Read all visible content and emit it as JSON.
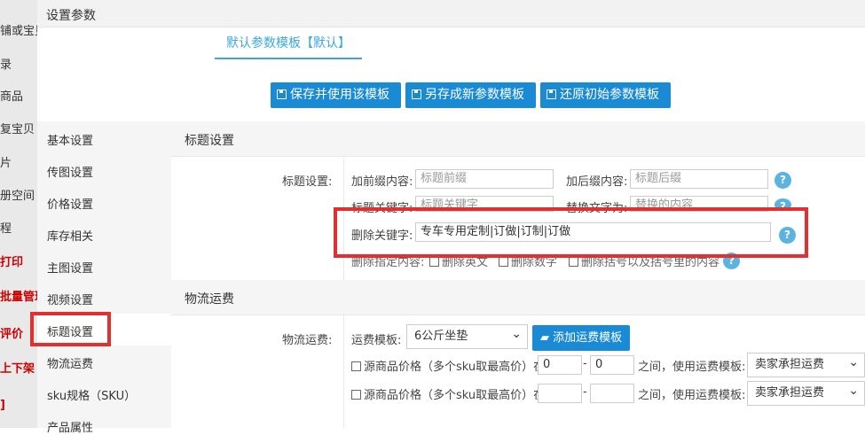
{
  "left_nav": {
    "items": [
      {
        "label": "铺或宝贝",
        "style": "normal"
      },
      {
        "label": "录",
        "style": "normal"
      },
      {
        "label": "商品",
        "style": "normal"
      },
      {
        "label": "复宝贝",
        "style": "normal"
      },
      {
        "label": "片",
        "style": "normal"
      },
      {
        "label": "册空间",
        "style": "normal"
      },
      {
        "label": "程",
        "style": "normal"
      },
      {
        "label": "打印",
        "style": "red"
      },
      {
        "label": "批量管理",
        "style": "red"
      },
      {
        "label": "评价",
        "style": "red"
      },
      {
        "label": "上下架",
        "style": "red"
      },
      {
        "label": "]",
        "style": "red"
      }
    ]
  },
  "header": {
    "title": "设置参数"
  },
  "tabs": [
    {
      "label": "默认参数模板【默认】",
      "active": true
    }
  ],
  "toolbar": {
    "save_use": "保存并使用该模板",
    "save_new": "另存成新参数模板",
    "restore": "还原初始参数模板"
  },
  "side_menu": {
    "items": [
      {
        "label": "基本设置"
      },
      {
        "label": "传图设置"
      },
      {
        "label": "价格设置"
      },
      {
        "label": "库存相关"
      },
      {
        "label": "主图设置"
      },
      {
        "label": "视频设置"
      },
      {
        "label": "标题设置",
        "active": true
      },
      {
        "label": "物流运费"
      },
      {
        "label": "sku规格（SKU）"
      },
      {
        "label": "产品属性"
      }
    ]
  },
  "title_section": {
    "heading": "标题设置",
    "row_label": "标题设置:",
    "prefix_label": "加前缀内容:",
    "prefix_placeholder": "标题前缀",
    "suffix_label": "加后缀内容:",
    "suffix_placeholder": "标题后缀",
    "keyword_label": "标题关键字:",
    "keyword_placeholder": "标题关键字",
    "replace_label": "替换文字为:",
    "replace_placeholder": "替换的内容",
    "delete_keywords_label": "删除关键字:",
    "delete_keywords_value": "专车专用定制|订做|订制|订做",
    "delete_specified_label": "删除指定内容:",
    "opt_english": "删除英文",
    "opt_digits": "删除数字",
    "opt_brackets": "删除括号以及括号里的内容",
    "help": "?"
  },
  "shipping_section": {
    "heading": "物流运费",
    "row_label": "物流运费:",
    "template_label": "运费模板:",
    "template_value": "6公斤坐垫",
    "add_button": "添加运费模板",
    "rule1": {
      "prefix": "源商品价格（多个sku取最高价）在:",
      "from": "0",
      "to": "0",
      "between": "之间，使用运费模板:",
      "option": "卖家承担运费"
    },
    "rule2": {
      "prefix": "源商品价格（多个sku取最高价）在:",
      "from": "",
      "to": "",
      "between": "之间，使用运费模板:",
      "option": "卖家承担运费"
    },
    "dash": "-"
  },
  "colors": {
    "accent": "#1a8ad4",
    "tab": "#3aa7e0",
    "highlight": "#e23030"
  }
}
